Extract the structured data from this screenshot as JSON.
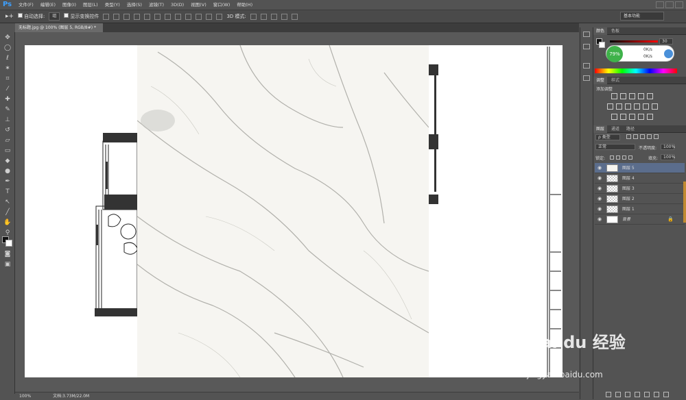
{
  "app": {
    "logo": "Ps"
  },
  "menu": [
    "文件(F)",
    "编辑(E)",
    "图像(I)",
    "图层(L)",
    "类型(Y)",
    "选择(S)",
    "滤镜(T)",
    "3D(D)",
    "视图(V)",
    "窗口(W)",
    "帮助(H)"
  ],
  "options": {
    "auto_select_label": "自动选择:",
    "auto_select_value": "组",
    "show_transform_label": "显示变换控件",
    "mode3d_label": "3D 模式:"
  },
  "workspace": "基本功能",
  "doc_tab": "无标题.jpg @ 100% (图层 5, RGB/8#) *",
  "status": {
    "zoom": "100%",
    "doc": "文档:3.73M/22.0M"
  },
  "color_panel": {
    "tabs": [
      "颜色",
      "色板"
    ],
    "r_value": "30",
    "speed_badge_percent": "79%",
    "up_speed": "0K/s",
    "down_speed": "0K/s"
  },
  "adjust_panel": {
    "tabs": [
      "调整",
      "样式"
    ],
    "title": "添加调整"
  },
  "layers_panel": {
    "tabs": [
      "图层",
      "通道",
      "路径"
    ],
    "filter_label": "ρ 类型",
    "blend_mode": "正常",
    "opacity_label": "不透明度:",
    "opacity_value": "100%",
    "lock_label": "锁定:",
    "fill_label": "填充:",
    "fill_value": "100%",
    "layers": [
      {
        "name": "图层 5",
        "selected": true
      },
      {
        "name": "图层 4",
        "selected": false
      },
      {
        "name": "图层 3",
        "selected": false
      },
      {
        "name": "图层 2",
        "selected": false
      },
      {
        "name": "图层 1",
        "selected": false
      },
      {
        "name": "背景",
        "selected": false
      }
    ]
  },
  "watermark": {
    "brand": "Bai du 经验",
    "url": "jingyan.baidu.com"
  },
  "colors": {
    "accent": "#3da0ff",
    "selected_layer": "#5b6d8c",
    "badge": "#3fb24a"
  }
}
